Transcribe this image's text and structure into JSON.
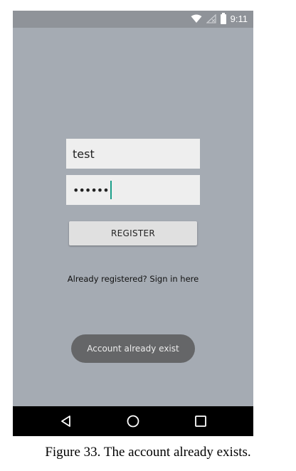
{
  "status_bar": {
    "time": "9:11"
  },
  "login_form": {
    "username_value": "test",
    "password_value": "••••••",
    "register_label": "REGISTER",
    "signin_link": "Already registered? Sign in here"
  },
  "toast": {
    "message": "Account already exist"
  },
  "nav_bar": {
    "icons": [
      "back-icon",
      "home-icon",
      "recents-icon"
    ]
  },
  "caption": "Figure 33. The account already exists.",
  "colors": {
    "screen_background": "#a5abb3",
    "status_bar": "#8f9399",
    "cursor_accent": "#1a9e8a",
    "toast_background": "#656668",
    "nav_bar": "#000000"
  }
}
